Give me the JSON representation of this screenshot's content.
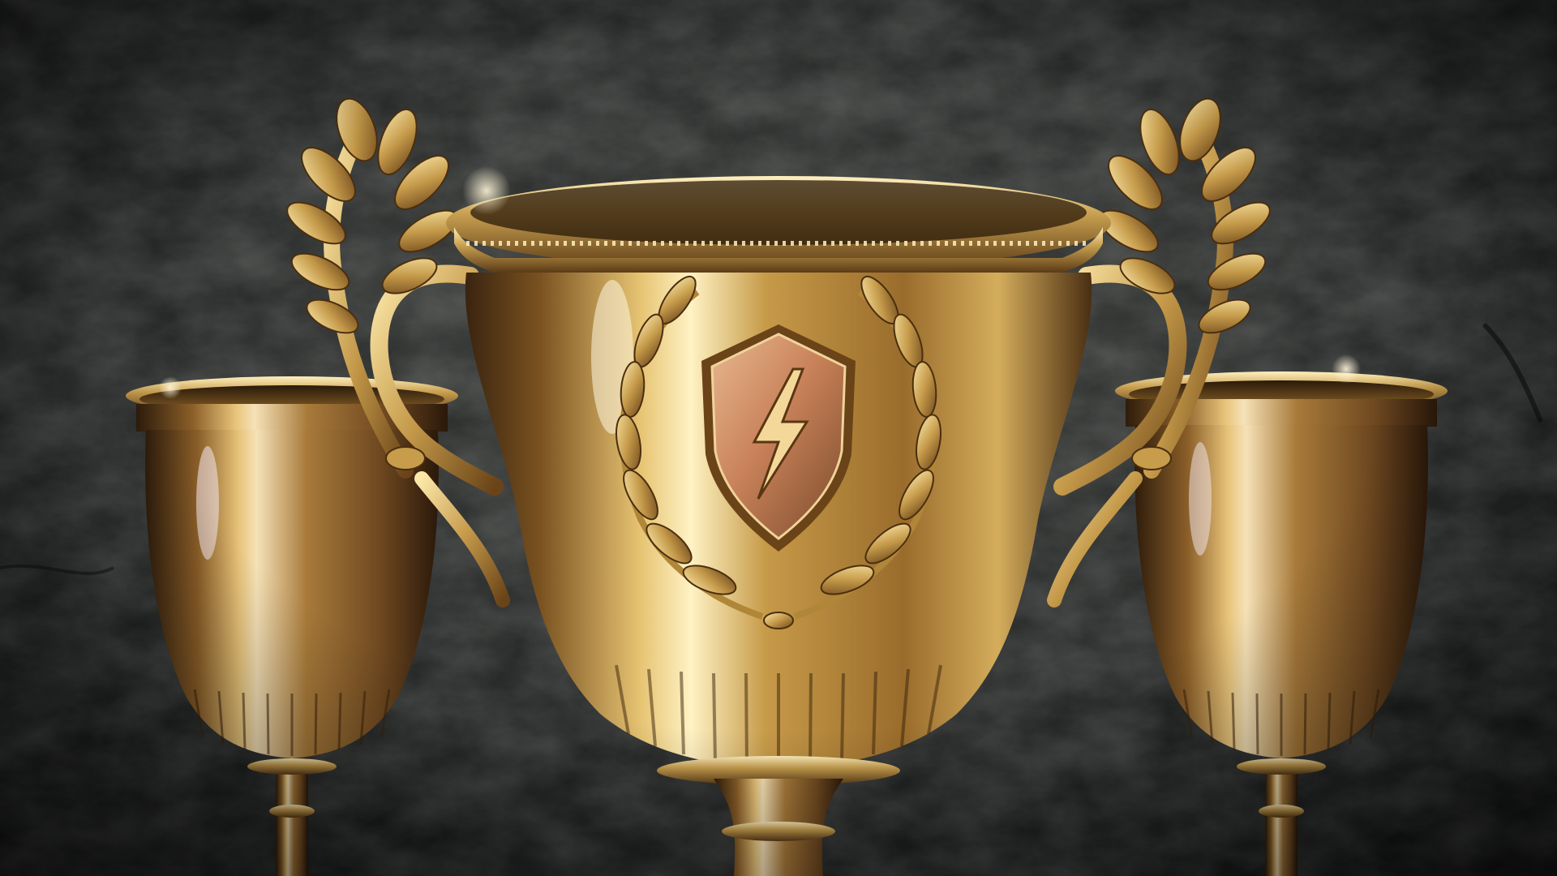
{
  "scene": {
    "subject": "three-gold-trophy-cups",
    "emblem_icon": "lightning-bolt-shield-icon",
    "background_texture": "dark-stone-wall",
    "colors": {
      "background_dark": "#161817",
      "background_mid": "#3a3d3a",
      "gold_highlight": "#fff4c8",
      "gold_light": "#e9c86f",
      "gold_mid": "#b68838",
      "gold_dark": "#5c3a14",
      "gold_shadow": "#2a1a0a",
      "copper_shield": "#c9825a"
    }
  }
}
